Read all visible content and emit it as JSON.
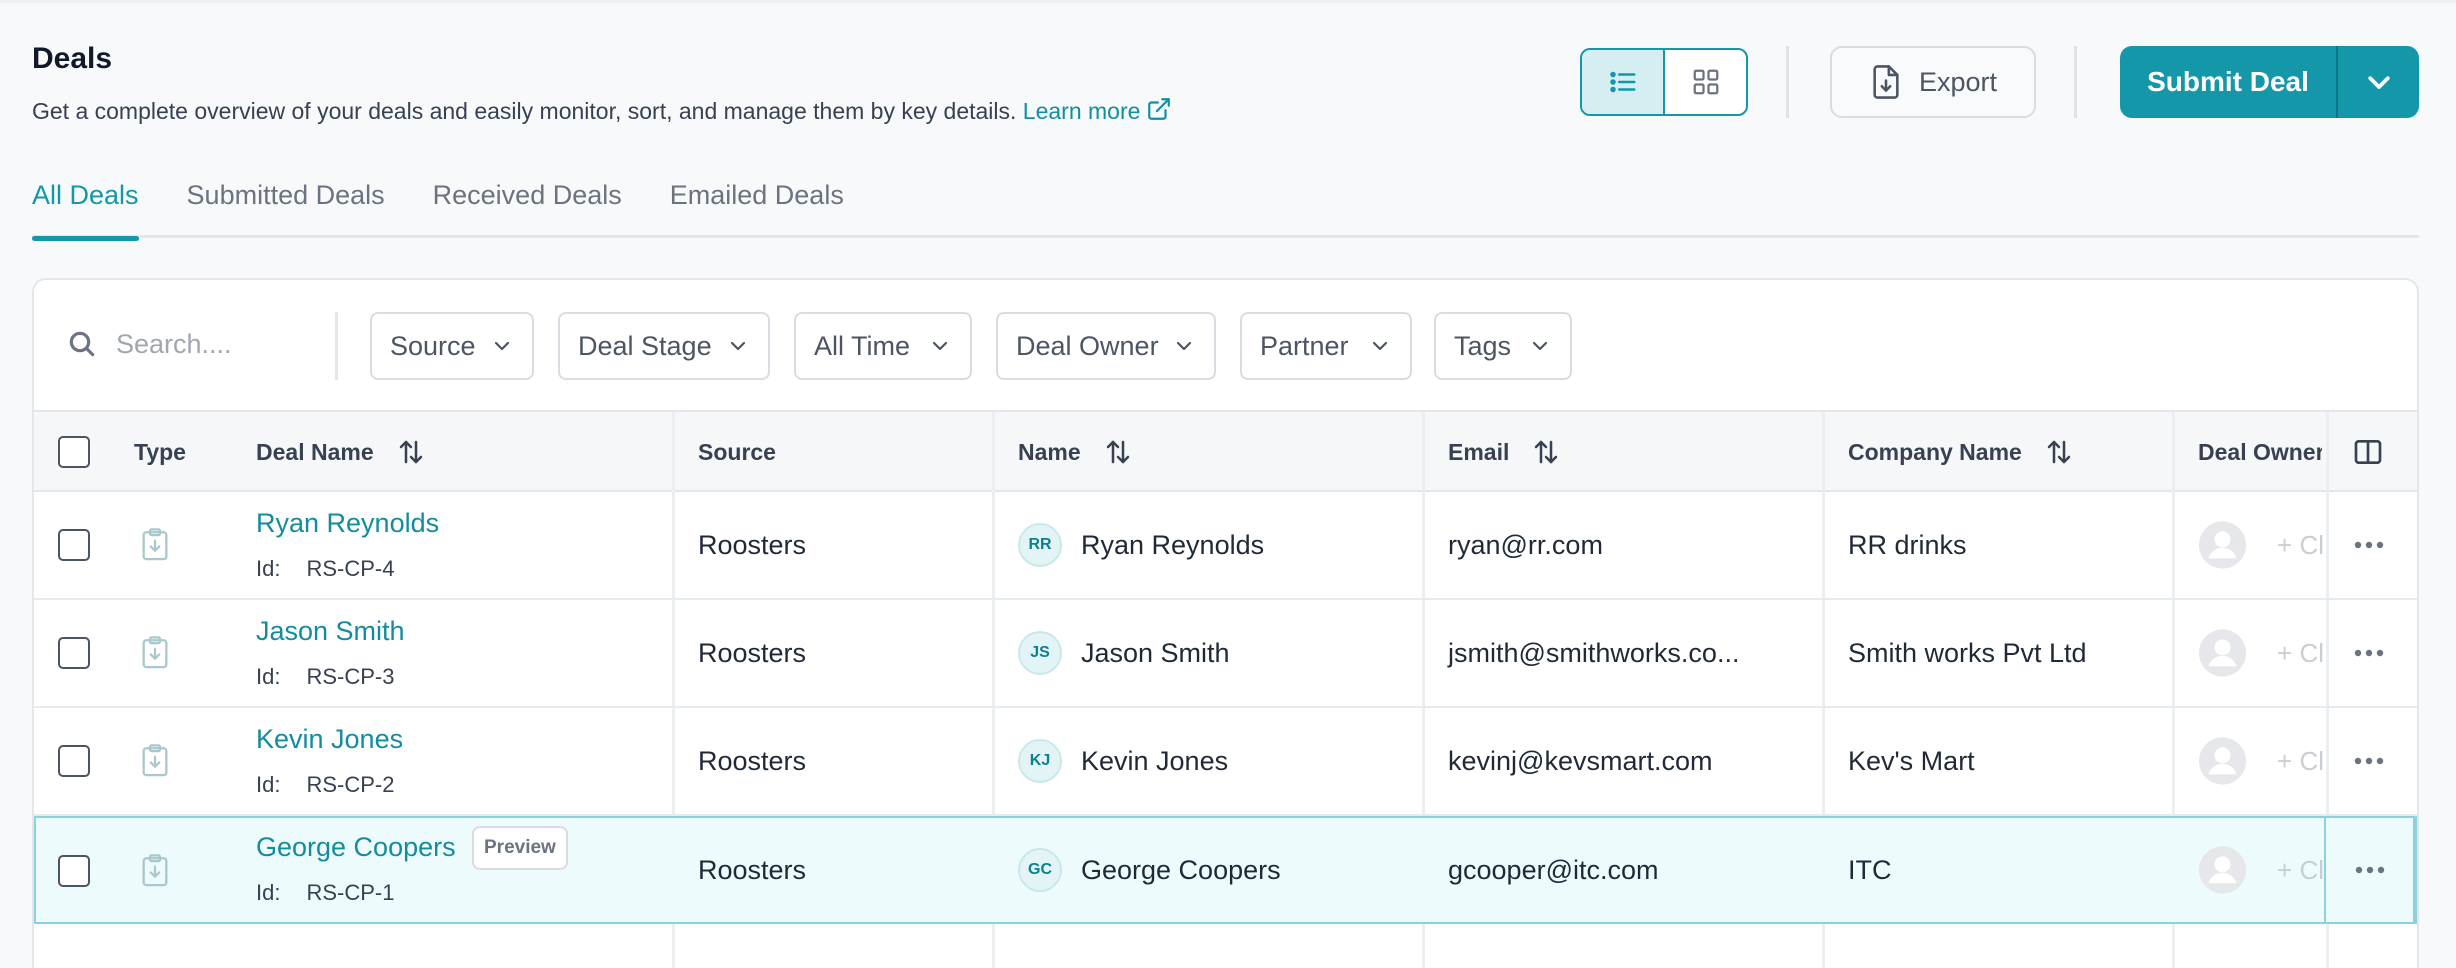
{
  "header": {
    "title": "Deals",
    "description": "Get a complete overview of your deals and easily monitor, sort, and manage them by key details.",
    "learn_more": "Learn more",
    "export_label": "Export",
    "submit_label": "Submit Deal"
  },
  "tabs": [
    {
      "label": "All Deals",
      "active": true
    },
    {
      "label": "Submitted Deals",
      "active": false
    },
    {
      "label": "Received Deals",
      "active": false
    },
    {
      "label": "Emailed Deals",
      "active": false
    }
  ],
  "search": {
    "placeholder": "Search...."
  },
  "filters": [
    "Source",
    "Deal Stage",
    "All Time",
    "Deal Owner",
    "Partner",
    "Tags"
  ],
  "table": {
    "columns": {
      "type": "Type",
      "deal_name": "Deal Name",
      "source": "Source",
      "name": "Name",
      "email": "Email",
      "company": "Company Name",
      "owner": "Deal Owner"
    },
    "id_label": "Id:",
    "owner_add": "+ Cl",
    "preview_label": "Preview",
    "rows": [
      {
        "deal_name": "Ryan Reynolds",
        "id": "RS-CP-4",
        "source": "Roosters",
        "initials": "RR",
        "name": "Ryan Reynolds",
        "email": "ryan@rr.com",
        "company": "RR drinks"
      },
      {
        "deal_name": "Jason Smith",
        "id": "RS-CP-3",
        "source": "Roosters",
        "initials": "JS",
        "name": "Jason Smith",
        "email": "jsmith@smithworks.co...",
        "company": "Smith works Pvt Ltd"
      },
      {
        "deal_name": "Kevin Jones",
        "id": "RS-CP-2",
        "source": "Roosters",
        "initials": "KJ",
        "name": "Kevin Jones",
        "email": "kevinj@kevsmart.com",
        "company": "Kev's Mart"
      },
      {
        "deal_name": "George Coopers",
        "id": "RS-CP-1",
        "source": "Roosters",
        "initials": "GC",
        "name": "George Coopers",
        "email": "gcooper@itc.com",
        "company": "ITC"
      }
    ]
  },
  "colors": {
    "accent": "#1497a9",
    "link": "#138c9e"
  }
}
